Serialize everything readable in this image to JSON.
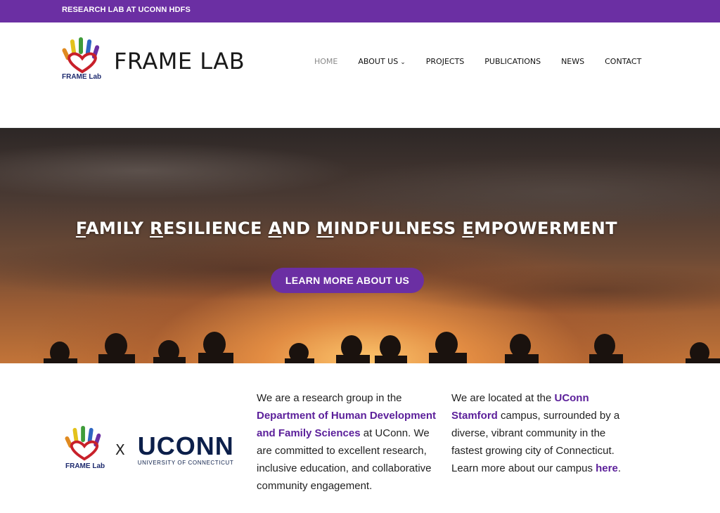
{
  "topbar": {
    "text": "RESEARCH LAB AT UCONN HDFS"
  },
  "brand": {
    "title": "FRAME LAB",
    "logo_caption": "FRAME Lab"
  },
  "nav": {
    "items": [
      {
        "label": "HOME"
      },
      {
        "label": "ABOUT US"
      },
      {
        "label": "PROJECTS"
      },
      {
        "label": "PUBLICATIONS"
      },
      {
        "label": "NEWS"
      },
      {
        "label": "CONTACT"
      }
    ]
  },
  "hero": {
    "title_parts": [
      {
        "initial": "F",
        "rest": "AMILY "
      },
      {
        "initial": "R",
        "rest": "ESILIENCE "
      },
      {
        "initial": "A",
        "rest": "ND "
      },
      {
        "initial": "M",
        "rest": "INDFULNESS "
      },
      {
        "initial": "E",
        "rest": "MPOWERMENT"
      }
    ],
    "button_label": "LEARN MORE ABOUT US"
  },
  "content": {
    "logos": {
      "frame_caption": "FRAME Lab",
      "x": "X",
      "uconn_word": "UCONN",
      "uconn_sub": "UNIVERSITY OF CONNECTICUT"
    },
    "col1": {
      "intro": "We are a research group in the ",
      "link": "Department of Human Development and Family Sciences",
      "after": " at UConn. We are committed to excellent research, inclusive education, and collaborative community engagement."
    },
    "col2": {
      "intro": "We are located at the ",
      "link": "UConn Stamford",
      "after": " campus, surrounded by a diverse, vibrant community in the fastest growing city of Connecticut. Learn more about our campus ",
      "link2": "here",
      "end": "."
    }
  },
  "colors": {
    "accent": "#6b2fa3",
    "link": "#5b1f9a",
    "uconn_navy": "#0c1f4a"
  }
}
